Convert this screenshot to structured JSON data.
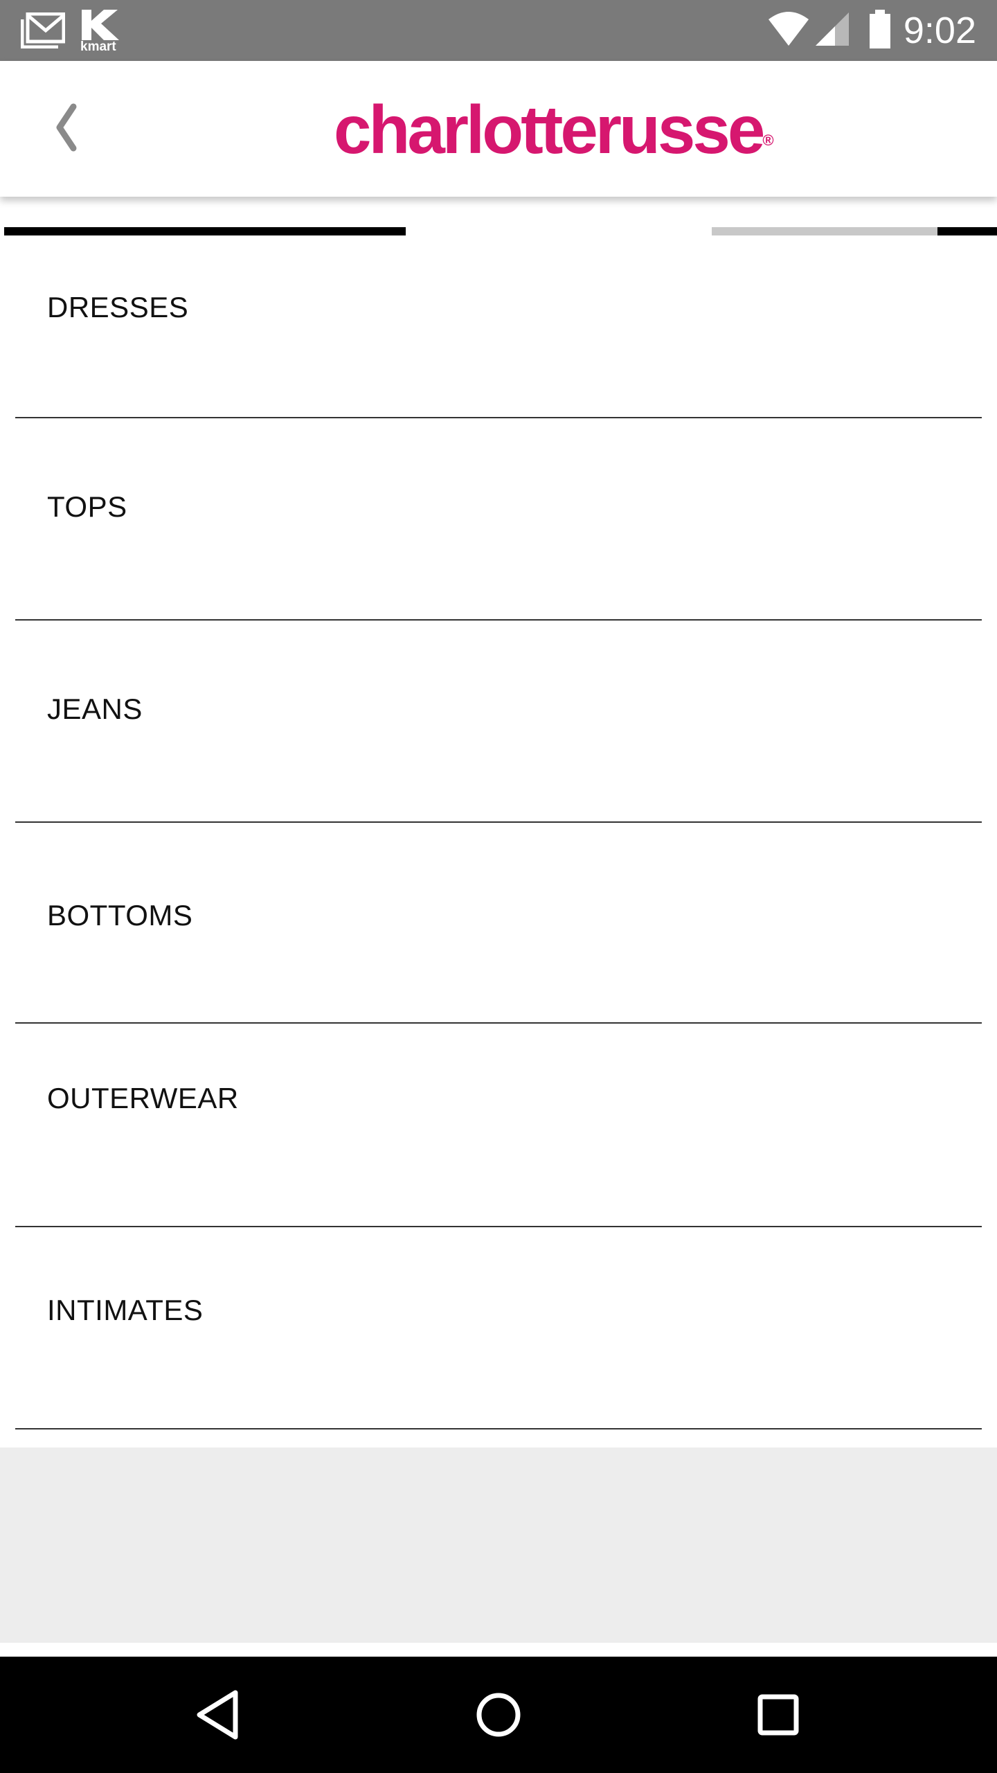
{
  "status_bar": {
    "time": "9:02",
    "notification_icons": [
      "gmail-icon",
      "kmart-icon"
    ],
    "kmart_label": "kmart",
    "system_icons": [
      "wifi-icon",
      "cell-signal-icon",
      "battery-icon"
    ]
  },
  "header": {
    "back_icon": "chevron-left-icon",
    "brand_name": "charlotterusse",
    "brand_mark": "®",
    "brand_color": "#d6176f"
  },
  "categories": [
    {
      "label": "DRESSES"
    },
    {
      "label": "TOPS"
    },
    {
      "label": "JEANS"
    },
    {
      "label": "BOTTOMS"
    },
    {
      "label": "OUTERWEAR"
    },
    {
      "label": "INTIMATES"
    }
  ],
  "nav_bar": {
    "buttons": [
      "back-triangle-icon",
      "home-circle-icon",
      "recents-square-icon"
    ]
  }
}
